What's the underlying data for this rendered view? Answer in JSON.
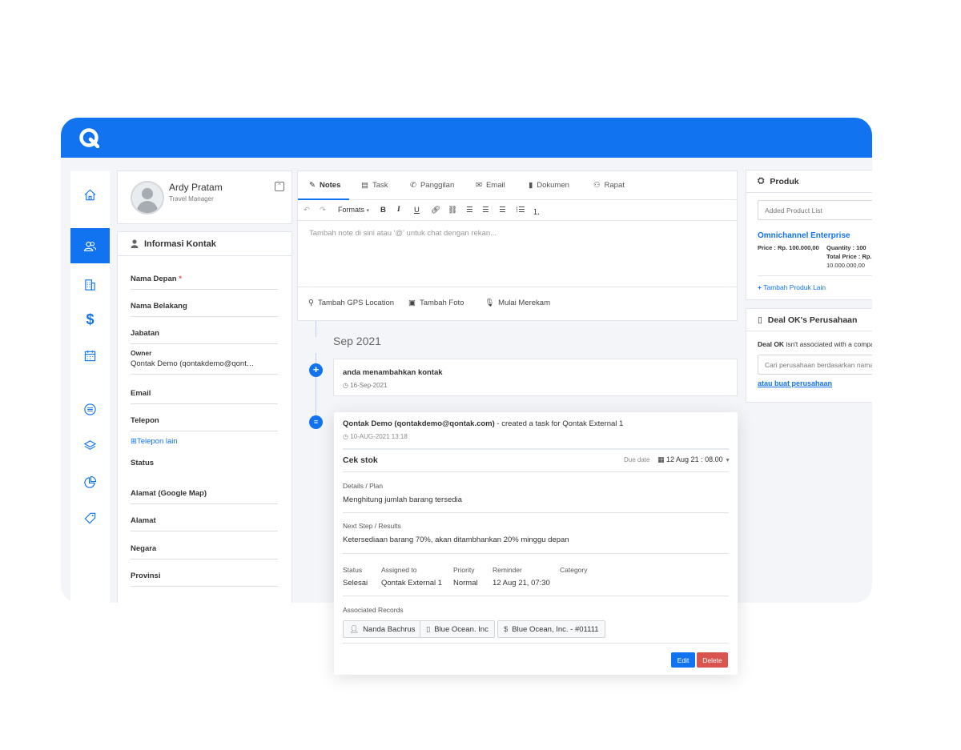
{
  "profile": {
    "name": "Ardy Pratam",
    "role": "Travel Manager",
    "collapse_icon": "chevrons-up-icon"
  },
  "contact": {
    "title": "Informasi Kontak",
    "fields": {
      "first_name": "Nama Depan",
      "required_mark": "*",
      "last_name": "Nama Belakang",
      "job_title": "Jabatan",
      "owner_label": "Owner",
      "owner_value": "Qontak Demo (qontakdemo@qont…",
      "email": "Email",
      "phone": "Telepon",
      "add_phone": "Telepon lain",
      "status": "Status",
      "map_address": "Alamat (Google Map)",
      "address": "Alamat",
      "country": "Negara",
      "province": "Provinsi"
    }
  },
  "notes": {
    "tabs": [
      "Notes",
      "Task",
      "Panggilan",
      "Email",
      "Dokumen",
      "Rapat"
    ],
    "toolbar": {
      "formats": "Formats",
      "bold": "B",
      "italic": "I",
      "underline": "U"
    },
    "placeholder": "Tambah note di sini atau '@' untuk chat dengan rekan...",
    "actions": [
      "Tambah GPS Location",
      "Tambah Foto",
      "Mulai Merekam"
    ]
  },
  "timeline": {
    "month": "Sep 2021",
    "activity1": {
      "title": "anda menambahkan kontak",
      "date": "16-Sep-2021"
    },
    "activity2": {
      "actor": "Qontak Demo (qontakdemo@qontak.com)",
      "action": " - created a task for Qontak External 1",
      "date": "10-AUG-2021 13:18"
    }
  },
  "task": {
    "title": "Cek stok",
    "due_label": "Due date",
    "due_value": "12 Aug 21 : 08.00",
    "details_label": "Details / Plan",
    "details_value": "Menghitung jumlah barang tersedia",
    "next_label": "Next Step / Results",
    "next_value": "Ketersediaan barang 70%, akan ditambhankan 20% minggu depan",
    "meta": {
      "status_label": "Status",
      "status_value": "Selesai",
      "assigned_label": "Assigned to",
      "assigned_value": "Qontak External 1",
      "priority_label": "Priority",
      "priority_value": "Normal",
      "reminder_label": "Reminder",
      "reminder_value": "12 Aug 21, 07:30",
      "category_label": "Category"
    },
    "assoc_label": "Associated Records",
    "records": [
      "Nanda Bachrus",
      "Blue Ocean. Inc",
      "Blue Ocean, Inc. - #01111"
    ],
    "edit": "Edit",
    "delete": "Delete"
  },
  "produk": {
    "title": "Produk",
    "list_placeholder": "Added Product List",
    "product_name": "Omnichannel Enterprise",
    "price": "Price : Rp. 100.000,00",
    "quantity": "Quantity : 100",
    "total_label": "Total Price : Rp.",
    "total_value": "10.000.000,00",
    "remove": "×",
    "add_more": "Tambah Produk Lain"
  },
  "deal": {
    "title": "Deal OK's Perusahaan",
    "bold": "Deal OK",
    "text": " isn't associated with a company.",
    "search_placeholder": "Cari perusahaan berdasarkan nama",
    "create_link": "atau buat perusahaan"
  },
  "colors": {
    "brand": "#1173f0",
    "danger": "#d9534f",
    "background": "#f3f5f9"
  },
  "rail_icons": [
    "home-icon",
    "users-icon",
    "building-icon",
    "dollar-icon",
    "calendar-icon",
    "list-icon",
    "layers-icon",
    "pie-chart-icon",
    "tag-icon"
  ]
}
